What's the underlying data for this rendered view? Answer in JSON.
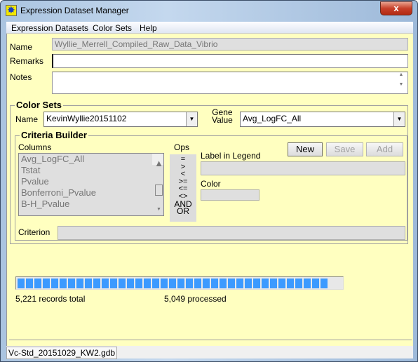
{
  "window": {
    "title": "Expression Dataset Manager",
    "close": "x"
  },
  "menu": [
    "Expression Datasets",
    "Color Sets",
    "Help"
  ],
  "dataset": {
    "name_label": "Name",
    "name_value": "Wyllie_Merrell_Compiled_Raw_Data_Vibrio",
    "remarks_label": "Remarks",
    "remarks_value": "",
    "notes_label": "Notes",
    "notes_value": ""
  },
  "color_sets": {
    "title": "Color Sets",
    "name_label": "Name",
    "name_value": "KevinWyllie20151102",
    "gene_label_1": "Gene",
    "gene_label_2": "Value",
    "gene_value": "Avg_LogFC_All"
  },
  "criteria": {
    "title": "Criteria Builder",
    "columns_label": "Columns",
    "columns": [
      "Avg_LogFC_All",
      "Tstat",
      "Pvalue",
      "Bonferroni_Pvalue",
      "B-H_Pvalue"
    ],
    "ops_label": "Ops",
    "ops": [
      "=",
      ">",
      "<",
      ">=",
      "<=",
      "<>",
      "AND",
      "OR"
    ],
    "new": "New",
    "save": "Save",
    "add": "Add",
    "legend_label": "Label in Legend",
    "color_label": "Color",
    "criterion_label": "Criterion"
  },
  "progress": {
    "total_text": "5,221 records total",
    "processed_text": "5,049 processed",
    "total": 5221,
    "processed": 5049,
    "color": "#3c9aff"
  },
  "status": {
    "file": "Vc-Std_20151029_KW2.gdb"
  }
}
